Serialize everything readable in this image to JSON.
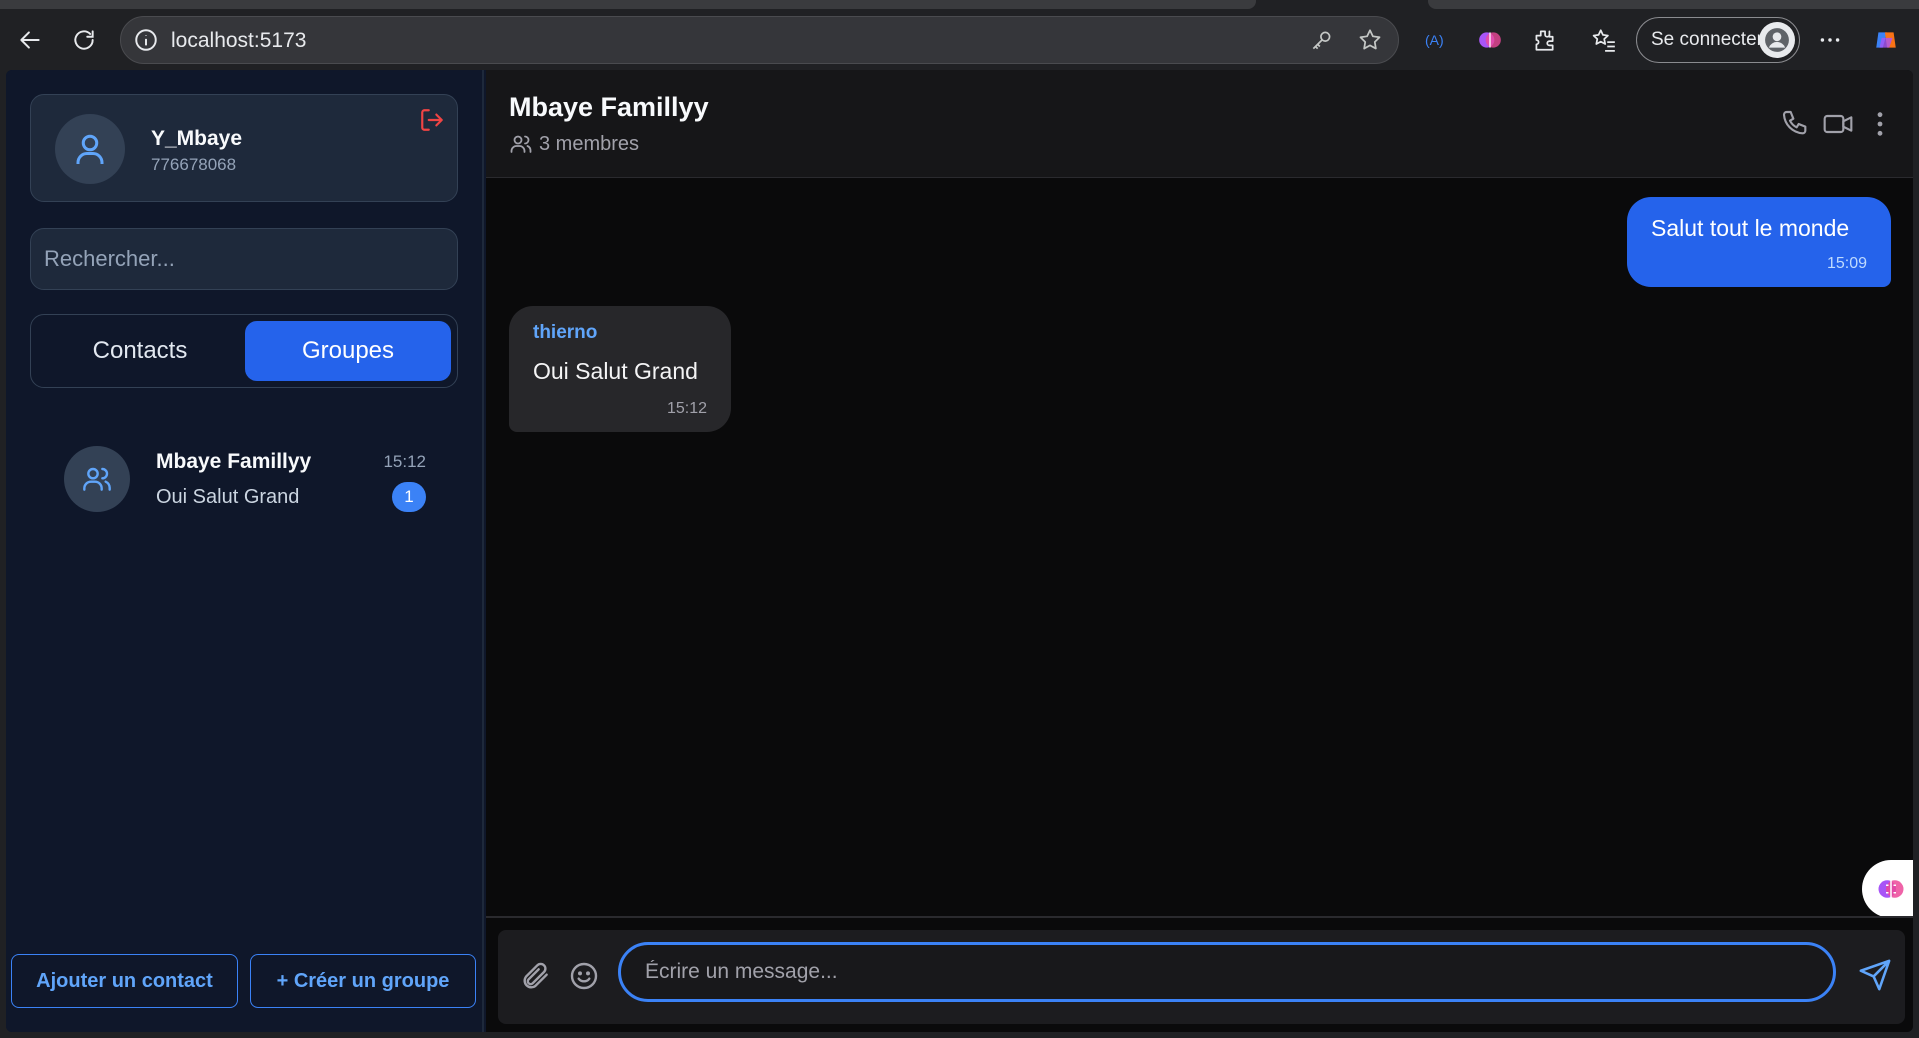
{
  "browser": {
    "url": "localhost:5173",
    "signin_label": "Se connecter"
  },
  "profile": {
    "name": "Y_Mbaye",
    "phone": "776678068"
  },
  "search": {
    "placeholder": "Rechercher..."
  },
  "tabs": {
    "contacts_label": "Contacts",
    "groups_label": "Groupes",
    "active": "Groupes"
  },
  "conversations": [
    {
      "name": "Mbaye Famillyy",
      "time": "15:12",
      "last_message": "Oui Salut Grand",
      "unread": "1"
    }
  ],
  "sidebar_footer": {
    "add_contact_label": "Ajouter un contact",
    "create_group_label": "+ Créer un groupe"
  },
  "chat": {
    "title": "Mbaye Famillyy",
    "members_text": "3 membres",
    "messages": [
      {
        "direction": "out",
        "text": "Salut tout le monde",
        "time": "15:09"
      },
      {
        "direction": "in",
        "sender": "thierno",
        "text": "Oui Salut Grand",
        "time": "15:12"
      }
    ],
    "composer_placeholder": "Écrire un message..."
  },
  "colors": {
    "accent": "#2563eb",
    "accent_light": "#60a5fa",
    "logout": "#ef4444",
    "sidebar_bg": "#0f172a",
    "chat_bg": "#0a0a0b"
  }
}
